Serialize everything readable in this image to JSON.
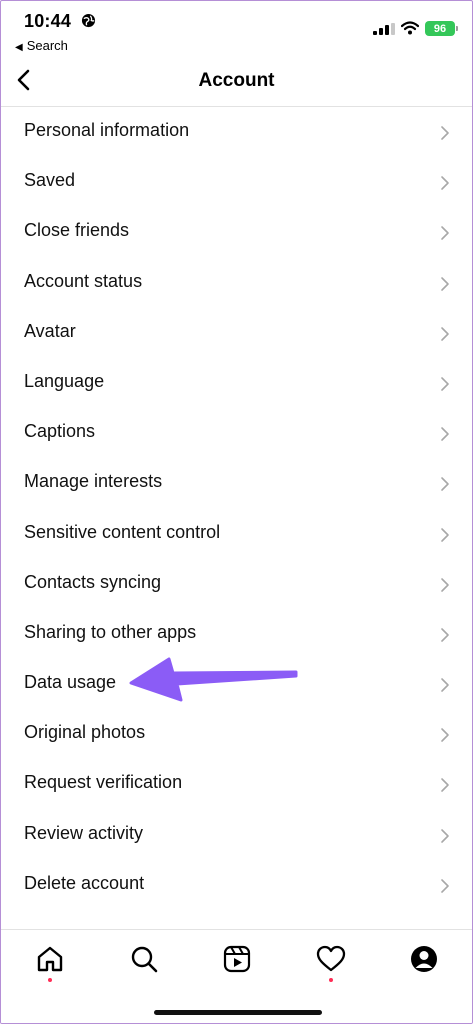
{
  "status_bar": {
    "time": "10:44",
    "back_app": "Search",
    "battery": "96"
  },
  "header": {
    "title": "Account"
  },
  "menu": {
    "items": [
      {
        "label": "Personal information"
      },
      {
        "label": "Saved"
      },
      {
        "label": "Close friends"
      },
      {
        "label": "Account status"
      },
      {
        "label": "Avatar"
      },
      {
        "label": "Language"
      },
      {
        "label": "Captions"
      },
      {
        "label": "Manage interests"
      },
      {
        "label": "Sensitive content control"
      },
      {
        "label": "Contacts syncing"
      },
      {
        "label": "Sharing to other apps"
      },
      {
        "label": "Data usage"
      },
      {
        "label": "Original photos"
      },
      {
        "label": "Request verification"
      },
      {
        "label": "Review activity"
      },
      {
        "label": "Delete account"
      }
    ]
  },
  "tabbar": {
    "icons": [
      "home-icon",
      "search-icon",
      "reels-icon",
      "heart-icon",
      "profile-icon"
    ]
  },
  "colors": {
    "annotation_arrow": "#8b5cf6",
    "battery": "#34c759",
    "notification_dot": "#ff2d55"
  }
}
